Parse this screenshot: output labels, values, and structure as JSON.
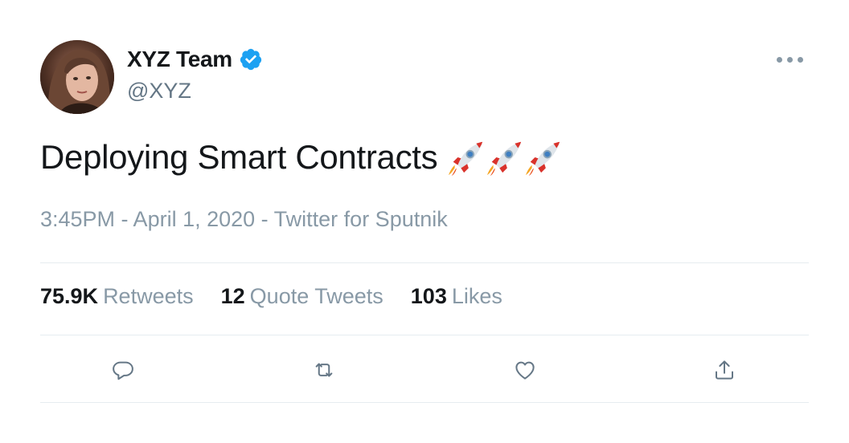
{
  "user": {
    "display_name": "XYZ Team",
    "handle": "@XYZ",
    "verified": true,
    "avatar": "profile-photo"
  },
  "tweet": {
    "text": "Deploying Smart Contracts",
    "emoji": [
      "rocket",
      "rocket",
      "rocket"
    ],
    "timestamp": "3:45PM - April 1, 2020 - Twitter for Sputnik"
  },
  "stats": {
    "retweets": {
      "count": "75.9K",
      "label": "Retweets"
    },
    "quote_tweets": {
      "count": "12",
      "label": "Quote Tweets"
    },
    "likes": {
      "count": "103",
      "label": "Likes"
    }
  },
  "icons": {
    "more": "more-options-icon",
    "reply": "reply-icon",
    "retweet": "retweet-icon",
    "like": "heart-icon",
    "share": "share-icon",
    "verified": "verified-badge-icon"
  },
  "colors": {
    "verified_blue": "#1da1f2",
    "text_primary": "#14171a",
    "text_secondary": "#657786",
    "icon_gray": "#657786",
    "divider": "#e6ecf0"
  }
}
